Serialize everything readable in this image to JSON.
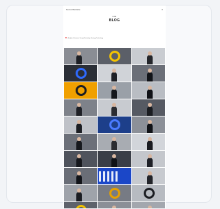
{
  "app": {
    "brand": "Norsk Website",
    "menu": "≡"
  },
  "header": {
    "kicker": "CIO",
    "title": "BLOG"
  },
  "categories": [
    "Analytics",
    "Business",
    "Design",
    "Marketing",
    "Strategy",
    "Technology"
  ],
  "tiles": [
    {
      "bg": "#8a8d94",
      "kind": "person",
      "fg": "#1d1f24"
    },
    {
      "bg": "#5b5f68",
      "kind": "circle",
      "fg": "#f5c400"
    },
    {
      "bg": "#c9ccd1",
      "kind": "person",
      "fg": "#24262b"
    },
    {
      "bg": "#2b2f37",
      "kind": "circle",
      "fg": "#2f6bff"
    },
    {
      "bg": "#d0d3d8",
      "kind": "person",
      "fg": "#1e2026"
    },
    {
      "bg": "#6b6f78",
      "kind": "person",
      "fg": "#111318"
    },
    {
      "bg": "#f0a000",
      "kind": "circle",
      "fg": "#1b1d22"
    },
    {
      "bg": "#9aa0a8",
      "kind": "person",
      "fg": "#15171c"
    },
    {
      "bg": "#b9bdc3",
      "kind": "person",
      "fg": "#101217"
    },
    {
      "bg": "#7e828a",
      "kind": "person",
      "fg": "#1e2026"
    },
    {
      "bg": "#c8cbd0",
      "kind": "person",
      "fg": "#2a2c31"
    },
    {
      "bg": "#565a63",
      "kind": "person",
      "fg": "#1a1c21"
    },
    {
      "bg": "#bfc2c8",
      "kind": "person",
      "fg": "#1c1e23"
    },
    {
      "bg": "#1d3f8a",
      "kind": "circle",
      "fg": "#4a7bff"
    },
    {
      "bg": "#8c9098",
      "kind": "person",
      "fg": "#101217"
    },
    {
      "bg": "#6c7079",
      "kind": "person",
      "fg": "#16181d"
    },
    {
      "bg": "#a8acb2",
      "kind": "person",
      "fg": "#2a2c31"
    },
    {
      "bg": "#d2d5da",
      "kind": "person",
      "fg": "#1a1c21"
    },
    {
      "bg": "#4f535c",
      "kind": "person",
      "fg": "#15171c"
    },
    {
      "bg": "#3a3e47",
      "kind": "person",
      "fg": "#101217"
    },
    {
      "bg": "#c4c7cc",
      "kind": "person",
      "fg": "#1e2026"
    },
    {
      "bg": "#6a6e77",
      "kind": "person",
      "fg": "#111318"
    },
    {
      "bg": "#1b47c8",
      "kind": "stripes",
      "fg": "#ffffff"
    },
    {
      "bg": "#c7cacf",
      "kind": "person",
      "fg": "#222429"
    },
    {
      "bg": "#9fa3aa",
      "kind": "person",
      "fg": "#1b1d22"
    },
    {
      "bg": "#777b84",
      "kind": "circle",
      "fg": "#e6a100"
    },
    {
      "bg": "#b7bbc1",
      "kind": "circle",
      "fg": "#1b1d22"
    },
    {
      "bg": "#5e626b",
      "kind": "circle",
      "fg": "#f2c200"
    },
    {
      "bg": "#8b8f97",
      "kind": "person",
      "fg": "#16181d"
    },
    {
      "bg": "#a3a7ae",
      "kind": "person",
      "fg": "#111318"
    }
  ]
}
